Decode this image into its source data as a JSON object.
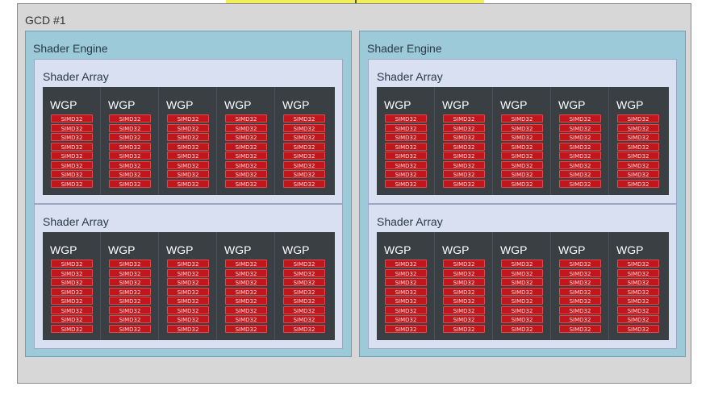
{
  "gcd": {
    "label": "GCD #1",
    "shader_engines": [
      {
        "label": "Shader Engine",
        "shader_arrays": [
          {
            "label": "Shader Array",
            "wgps": [
              "WGP",
              "WGP",
              "WGP",
              "WGP",
              "WGP"
            ]
          },
          {
            "label": "Shader Array",
            "wgps": [
              "WGP",
              "WGP",
              "WGP",
              "WGP",
              "WGP"
            ]
          }
        ]
      },
      {
        "label": "Shader Engine",
        "shader_arrays": [
          {
            "label": "Shader Array",
            "wgps": [
              "WGP",
              "WGP",
              "WGP",
              "WGP",
              "WGP"
            ]
          },
          {
            "label": "Shader Array",
            "wgps": [
              "WGP",
              "WGP",
              "WGP",
              "WGP",
              "WGP"
            ]
          }
        ]
      }
    ]
  },
  "simd_label": "SIMD32",
  "simd_per_wgp": 8,
  "colors": {
    "top_bar": "#f2ef5a",
    "top_bar_border": "#c9c63a",
    "gcd_bg": "#d7d7d7",
    "shader_engine_bg": "#9ccad8",
    "shader_array_bg": "#d8e0f2",
    "wgp_bg": "#3a3f44",
    "simd_bg": "#c0161c",
    "simd_border": "#e0484c",
    "arrow": "#555555"
  }
}
